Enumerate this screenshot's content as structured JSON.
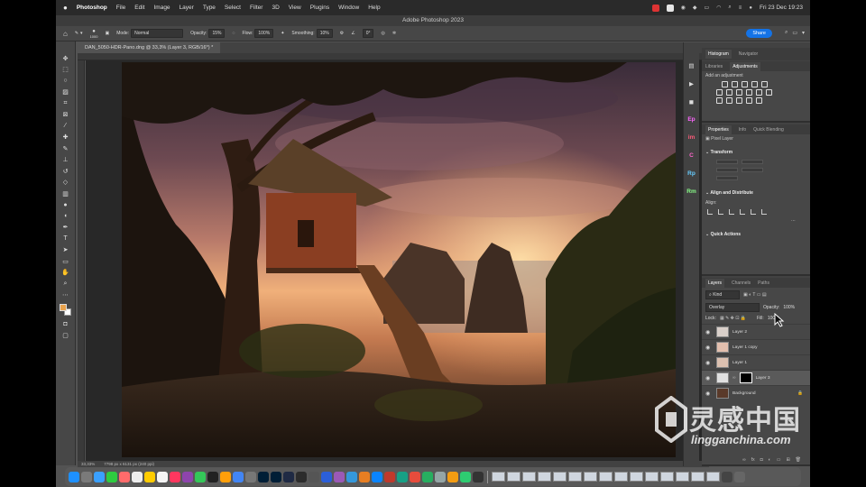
{
  "menubar": {
    "app": "Photoshop",
    "items": [
      "File",
      "Edit",
      "Image",
      "Layer",
      "Type",
      "Select",
      "Filter",
      "3D",
      "View",
      "Plugins",
      "Window",
      "Help"
    ],
    "clock": "Fri 23 Dec 19:23"
  },
  "window": {
    "title": "Adobe Photoshop 2023"
  },
  "options": {
    "brush_size": "1000",
    "mode_label": "Mode:",
    "mode_value": "Normal",
    "opacity_label": "Opacity:",
    "opacity_value": "15%",
    "flow_label": "Flow:",
    "flow_value": "100%",
    "smoothing_label": "Smoothing:",
    "smoothing_value": "10%",
    "angle_value": "0°",
    "share_label": "Share"
  },
  "document": {
    "tab_title": "DAN_5050-HDR-Pano.dng @ 33,3% (Layer 3, RGB/16*) *",
    "zoom": "33,33%",
    "size": "7798 px x 6131 px (240 ppi)"
  },
  "panels": {
    "histogram_tabs": [
      "Histogram",
      "Navigator"
    ],
    "adjust_tabs": [
      "Libraries",
      "Adjustments"
    ],
    "add_adjustment": "Add an adjustment",
    "props_tabs": [
      "Properties",
      "Info",
      "Quick Blending"
    ],
    "pixel_layer": "Pixel Layer",
    "transform": "Transform",
    "align_distribute": "Align and Distribute",
    "align_label": "Align:",
    "quick_actions": "Quick Actions",
    "layers_tabs": [
      "Layers",
      "Channels",
      "Paths"
    ],
    "kind_label": "Kind",
    "blend_mode": "Overlay",
    "opacity_label": "Opacity:",
    "opacity_value": "100%",
    "lock_label": "Lock:",
    "fill_label": "Fill:",
    "fill_value": "100%"
  },
  "layers": [
    {
      "name": "Layer 2",
      "thumb": "#d9cfc9"
    },
    {
      "name": "Layer 1 copy",
      "thumb": "#e3bfae"
    },
    {
      "name": "Layer 1",
      "thumb": "#dcc0b0"
    },
    {
      "name": "Layer 3",
      "thumb": "#e0e0e0"
    },
    {
      "name": "Background",
      "thumb": "#5a3a2a"
    }
  ],
  "minibar": [
    "Ep",
    "im",
    "C",
    "Rp",
    "Rm"
  ],
  "watermark": {
    "cn": "灵感中国",
    "en": "lingganchina.com"
  },
  "colors": {
    "accent": "#1473e6",
    "fg_color": "#e8a24c"
  }
}
